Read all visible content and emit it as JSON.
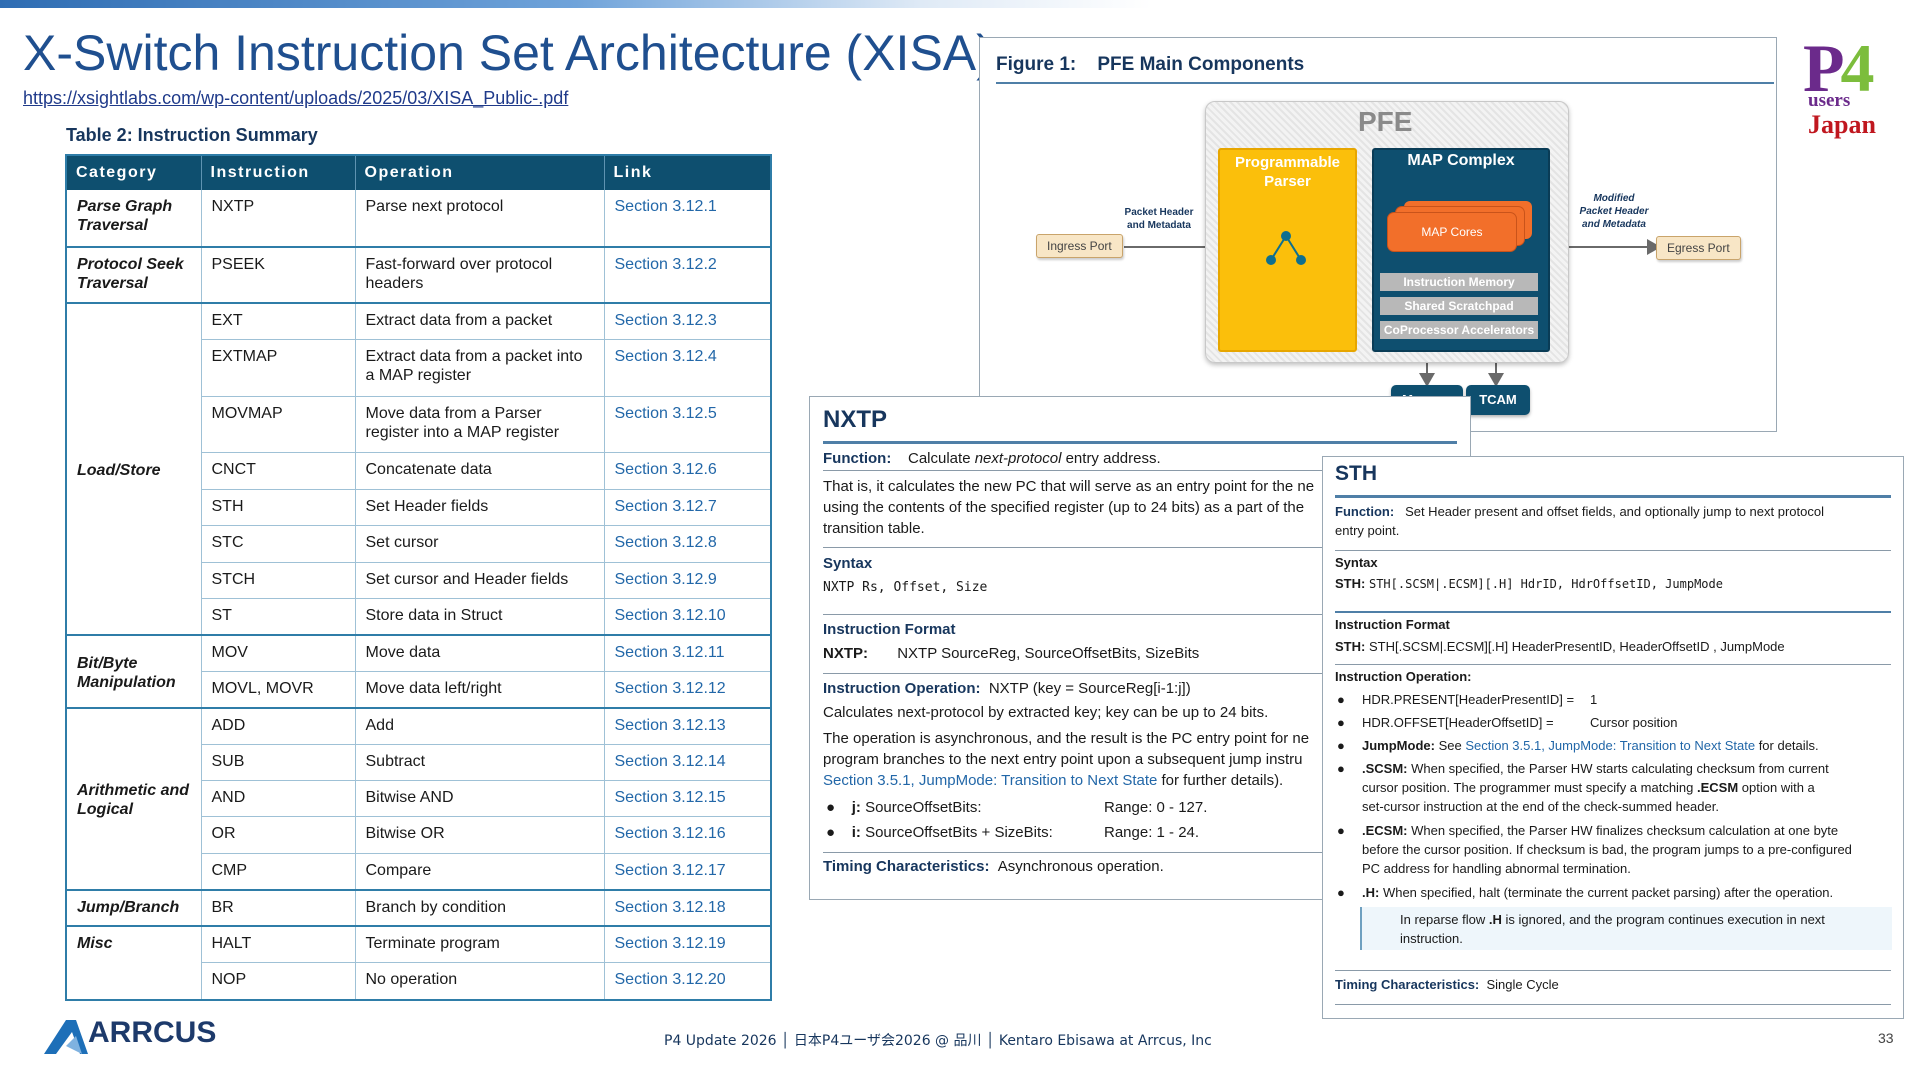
{
  "slide": {
    "title": "X-Switch Instruction Set Architecture (XISA)",
    "url": "https://xsightlabs.com/wp-content/uploads/2025/03/XISA_Public-.pdf",
    "table_caption": "Table 2: Instruction Summary",
    "footer": "P4 Update 2026 │ 日本P4ユーザ会2026 @ 品川 │ Kentaro Ebisawa at Arrcus, Inc",
    "page_number": "33",
    "arcus_logo": "ARRCUS",
    "p4_logo": {
      "p": "P",
      "four": "4",
      "users": "users",
      "japan": "Japan"
    }
  },
  "table": {
    "headers": [
      "Category",
      "Instruction",
      "Operation",
      "Link"
    ],
    "categories": {
      "parse_graph": "Parse Graph Traversal",
      "protocol_seek": "Protocol Seek Traversal",
      "load_store": "Load/Store",
      "bit_byte": "Bit/Byte Manipulation",
      "arith": "Arithmetic and Logical",
      "jump": "Jump/Branch",
      "misc": "Misc"
    },
    "rows": [
      {
        "ins": "NXTP",
        "op": "Parse next protocol",
        "link": "Section 3.12.1"
      },
      {
        "ins": "PSEEK",
        "op": "Fast-forward over protocol headers",
        "link": "Section 3.12.2"
      },
      {
        "ins": "EXT",
        "op": "Extract data from a packet",
        "link": "Section 3.12.3"
      },
      {
        "ins": "EXTMAP",
        "op": "Extract data from a packet into a MAP register",
        "link": "Section 3.12.4"
      },
      {
        "ins": "MOVMAP",
        "op": "Move data from a Parser register into a MAP register",
        "link": "Section 3.12.5"
      },
      {
        "ins": "CNCT",
        "op": "Concatenate data",
        "link": "Section 3.12.6"
      },
      {
        "ins": "STH",
        "op": "Set Header fields",
        "link": "Section 3.12.7"
      },
      {
        "ins": "STC",
        "op": "Set cursor",
        "link": "Section 3.12.8"
      },
      {
        "ins": "STCH",
        "op": "Set cursor and Header fields",
        "link": "Section 3.12.9"
      },
      {
        "ins": "ST",
        "op": "Store data in Struct",
        "link": "Section 3.12.10"
      },
      {
        "ins": "MOV",
        "op": "Move data",
        "link": "Section 3.12.11"
      },
      {
        "ins": "MOVL, MOVR",
        "op": "Move data left/right",
        "link": "Section 3.12.12"
      },
      {
        "ins": "ADD",
        "op": "Add",
        "link": "Section 3.12.13"
      },
      {
        "ins": "SUB",
        "op": "Subtract",
        "link": "Section 3.12.14"
      },
      {
        "ins": "AND",
        "op": "Bitwise AND",
        "link": "Section 3.12.15"
      },
      {
        "ins": "OR",
        "op": "Bitwise OR",
        "link": "Section 3.12.16"
      },
      {
        "ins": "CMP",
        "op": "Compare",
        "link": "Section 3.12.17"
      },
      {
        "ins": "BR",
        "op": "Branch by condition",
        "link": "Section 3.12.18"
      },
      {
        "ins": "HALT",
        "op": "Terminate program",
        "link": "Section 3.12.19"
      },
      {
        "ins": "NOP",
        "op": "No operation",
        "link": "Section 3.12.20"
      }
    ]
  },
  "figure": {
    "title": "Figure 1:",
    "subtitle": "PFE Main Components",
    "pfe": "PFE",
    "parser": "Programmable Parser",
    "map_complex": "MAP Complex",
    "map_cores": "MAP Cores",
    "bars": [
      "Instruction Memory",
      "Shared Scratchpad",
      "CoProcessor Accelerators"
    ],
    "ingress": "Ingress Port",
    "egress": "Egress Port",
    "in_annot": "Packet Header and Metadata",
    "out_annot": "Modified Packet Header and Metadata",
    "memory": "Memory",
    "tcam": "TCAM"
  },
  "nxtp": {
    "title": "NXTP",
    "function_label": "Function:",
    "function_a": "Calculate ",
    "function_em": "next-protocol",
    "function_b": " entry address.",
    "desc1": "That is, it calculates the new PC that will serve as an entry point for the ne",
    "desc2": "using the contents of the specified register (up to 24 bits) as a part of the",
    "desc3": "transition table.",
    "syntax_label": "Syntax",
    "syntax": "NXTP Rs, Offset, Size",
    "format_label": "Instruction Format",
    "format_name": "NXTP:",
    "format_value": "NXTP SourceReg,  SourceOffsetBits, SizeBits",
    "op_label": "Instruction Operation:",
    "op_value": "NXTP (key = SourceReg[i-1:j])",
    "op1": "Calculates next-protocol by extracted key; key can be up to 24 bits.",
    "op2": "The operation is asynchronous, and the result is the PC entry point for ne",
    "op3": "program branches to the next entry point upon a subsequent jump instru",
    "op4_link": "Section 3.5.1, JumpMode: Transition to Next State",
    "op4_rest": " for further details).",
    "b1_label": "j:",
    "b1_text": "SourceOffsetBits:",
    "b1_range": "Range: 0 - 127.",
    "b2_label": "i:",
    "b2_text": "SourceOffsetBits + SizeBits:",
    "b2_range": "Range: 1 - 24.",
    "timing_label": "Timing Characteristics:",
    "timing": "Asynchronous operation."
  },
  "sth": {
    "title": "STH",
    "function_label": "Function:",
    "function1": "Set Header present and offset fields, and optionally jump to next protocol",
    "function2": "entry point.",
    "syntax_label": "Syntax",
    "syntax_name": "STH:",
    "syntax": "STH[.SCSM|.ECSM][.H] HdrID, HdrOffsetID, JumpMode",
    "format_label": "Instruction Format",
    "format_name": "STH:",
    "format_value": "STH[.SCSM|.ECSM][.H] HeaderPresentID, HeaderOffsetID , JumpMode",
    "op_label": "Instruction Operation:",
    "b1": "HDR.PRESENT[HeaderPresentID] =",
    "b1v": "1",
    "b2": "HDR.OFFSET[HeaderOffsetID] =",
    "b2v": "Cursor position",
    "b3_label": "JumpMode:",
    "b3_a": " See ",
    "b3_link": "Section 3.5.1, JumpMode: Transition to Next State",
    "b3_b": " for details.",
    "b4_label": ".SCSM:",
    "b4_1": " When specified, the Parser HW starts calculating checksum from current",
    "b4_2a": "cursor position. The programmer must specify a matching ",
    "b4_2b": ".ECSM",
    "b4_2c": " option with a",
    "b4_3": "set-cursor instruction at the end of the check-summed header.",
    "b5_label": ".ECSM:",
    "b5_1": " When specified, the Parser HW finalizes checksum calculation at one byte",
    "b5_2": "before the cursor position. If checksum is bad, the program jumps to a pre-configured",
    "b5_3": "PC address for handling abnormal termination.",
    "b6_label": ".H:",
    "b6": " When specified, halt (terminate the current packet parsing) after the operation.",
    "note_a": "In reparse flow ",
    "note_b": ".H",
    "note_c": " is ignored, and the program continues execution in next",
    "note_2": "instruction.",
    "timing_label": "Timing Characteristics:",
    "timing": "Single Cycle"
  }
}
